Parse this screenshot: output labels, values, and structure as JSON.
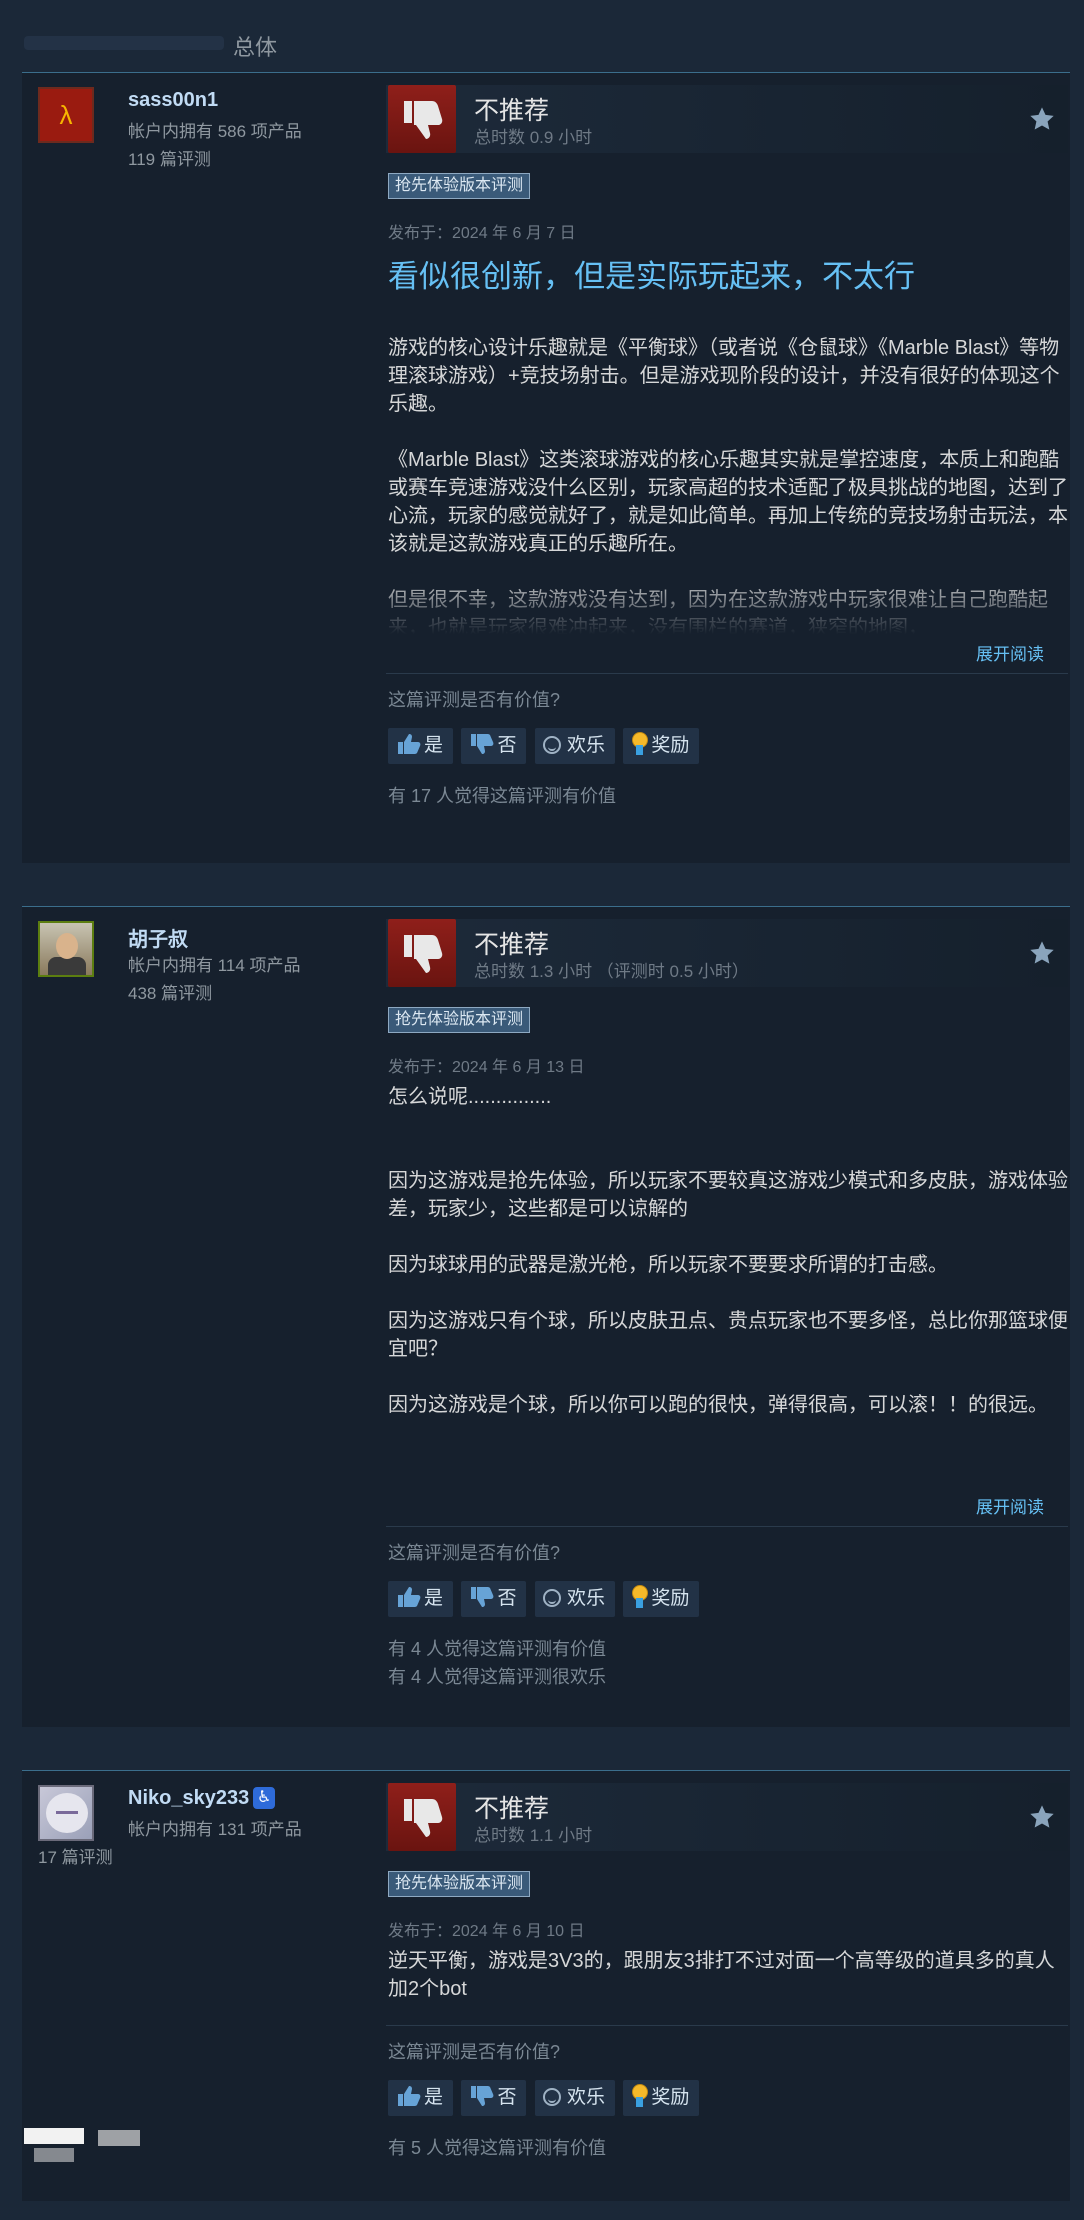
{
  "header": {
    "filter_label": "总体"
  },
  "reviews": [
    {
      "name": "sass00n1",
      "products": "帐户内拥有 586 项产品",
      "review_count": "119 篇评测",
      "verdict": "不推荐",
      "hours": "总时数 0.9 小时",
      "badge": "抢先体验版本评测",
      "posted": "发布于：2024 年 6 月 7 日",
      "title": "看似很创新，但是实际玩起来，不太行",
      "paragraphs": [
        "游戏的核心设计乐趣就是《平衡球》（或者说《仓鼠球》《Marble Blast》等物理滚球游戏）+竞技场射击。但是游戏现阶段的设计，并没有很好的体现这个乐趣。",
        "《Marble Blast》这类滚球游戏的核心乐趣其实就是掌控速度，本质上和跑酷或赛车竞速游戏没什么区别，玩家高超的技术适配了极具挑战的地图，达到了心流，玩家的感觉就好了，就是如此简单。再加上传统的竞技场射击玩法，本该就是这款游戏真正的乐趣所在。",
        "但是很不幸，这款游戏没有达到，因为在这款游戏中玩家很难让自己跑酷起来，也就是玩家很难冲起来，没有围栏的赛道，狭窄的地图，"
      ],
      "expand": "展开阅读",
      "helpful_q": "这篇评测是否有价值?",
      "btn_yes": "是",
      "btn_no": "否",
      "btn_funny": "欢乐",
      "btn_award": "奖励",
      "found_helpful": "有 17 人觉得这篇评测有价值"
    },
    {
      "name": "胡子叔",
      "products": "帐户内拥有 114 项产品",
      "review_count": "438 篇评测",
      "verdict": "不推荐",
      "hours": "总时数 1.3 小时 （评测时 0.5 小时）",
      "badge": "抢先体验版本评测",
      "posted": "发布于：2024 年 6 月 13 日",
      "paragraphs": [
        "怎么说呢...............",
        "因为这游戏是抢先体验，所以玩家不要较真这游戏少模式和多皮肤，游戏体验差，玩家少，这些都是可以谅解的",
        "因为球球用的武器是激光枪，所以玩家不要要求所谓的打击感。",
        "因为这游戏只有个球，所以皮肤丑点、贵点玩家也不要多怪，总比你那篮球便宜吧？",
        "因为这游戏是个球，所以你可以跑的很快，弹得很高，可以滚！！的很远。"
      ],
      "expand": "展开阅读",
      "helpful_q": "这篇评测是否有价值?",
      "btn_yes": "是",
      "btn_no": "否",
      "btn_funny": "欢乐",
      "btn_award": "奖励",
      "found_helpful": "有 4 人觉得这篇评测有价值",
      "found_funny": "有 4 人觉得这篇评测很欢乐"
    },
    {
      "name": "Niko_sky233",
      "products": "帐户内拥有 131 项产品",
      "review_count": "17 篇评测",
      "verdict": "不推荐",
      "hours": "总时数 1.1 小时",
      "badge": "抢先体验版本评测",
      "posted": "发布于：2024 年 6 月 10 日",
      "paragraphs": [
        "逆天平衡，游戏是3V3的，跟朋友3排打不过对面一个高等级的道具多的真人加2个bot"
      ],
      "helpful_q": "这篇评测是否有价值?",
      "btn_yes": "是",
      "btn_no": "否",
      "btn_funny": "欢乐",
      "btn_award": "奖励",
      "found_helpful": "有 5 人觉得这篇评测有价值"
    }
  ],
  "colors": {
    "background": "#1b2838",
    "panel": "#16202d",
    "link": "#66c0f4",
    "not_recommended": "#8f1f1a"
  }
}
